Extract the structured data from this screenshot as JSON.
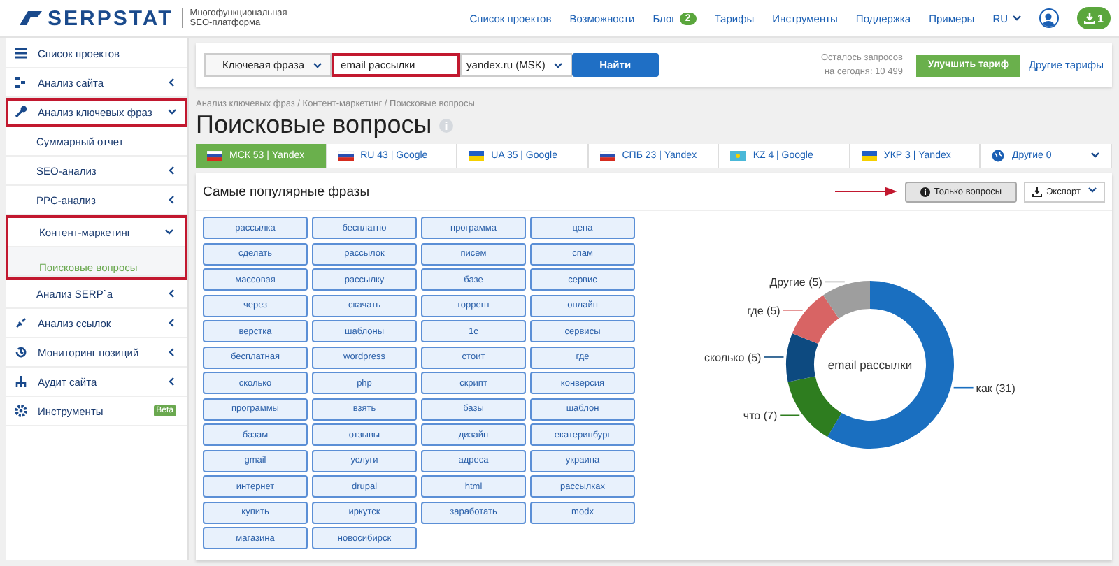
{
  "header": {
    "logo": "SERPSTAT",
    "tagline_1": "Многофункциональная",
    "tagline_2": "SEO-платформа",
    "nav": [
      {
        "label": "Список проектов"
      },
      {
        "label": "Возможности"
      },
      {
        "label": "Блог",
        "badge": "2"
      },
      {
        "label": "Тарифы"
      },
      {
        "label": "Инструменты"
      },
      {
        "label": "Поддержка"
      },
      {
        "label": "Примеры"
      }
    ],
    "language": "RU",
    "downloads": "1"
  },
  "sidebar": {
    "items": [
      {
        "label": "Список проектов",
        "highlighted": false
      },
      {
        "label": "Анализ сайта",
        "expanded": false,
        "highlighted": false
      },
      {
        "label": "Анализ ключевых фраз",
        "expanded": true,
        "highlighted": true,
        "children": [
          {
            "label": "Суммарный отчет",
            "selected": false,
            "highlighted": false
          },
          {
            "label": "SEO-анализ",
            "selected": false,
            "expanded": false,
            "highlighted": false,
            "collapsible": true
          },
          {
            "label": "PPC-анализ",
            "selected": false,
            "expanded": false,
            "highlighted": false,
            "collapsible": true
          },
          {
            "label": "Контент-маркетинг",
            "selected": false,
            "expanded": true,
            "highlighted": true,
            "collapsible": true,
            "children": [
              {
                "label": "Поисковые вопросы",
                "selected": true
              }
            ]
          },
          {
            "label": "Анализ SERP`a",
            "selected": false,
            "expanded": false,
            "highlighted": false,
            "collapsible": true
          }
        ]
      },
      {
        "label": "Анализ ссылок",
        "expanded": false,
        "highlighted": false
      },
      {
        "label": "Мониторинг позиций",
        "expanded": false,
        "highlighted": false
      },
      {
        "label": "Аудит сайта",
        "expanded": false,
        "highlighted": false
      },
      {
        "label": "Инструменты",
        "highlighted": false,
        "badge": "Beta"
      }
    ]
  },
  "search": {
    "type": "Ключевая фраза",
    "query": "email рассылки",
    "query_highlighted": true,
    "engine": "yandex.ru (MSK)",
    "button": "Найти",
    "quota_1": "Осталось запросов",
    "quota_2": "на сегодня: 10 499",
    "upgrade": "Улучшить тариф",
    "other_plans": "Другие тарифы"
  },
  "breadcrumb": "Анализ ключевых фраз / Контент-маркетинг / Поисковые вопросы",
  "title": "Поисковые вопросы",
  "regions": [
    {
      "label": "МСК 53 | Yandex",
      "selected": true
    },
    {
      "label": "RU 43 | Google",
      "selected": false
    },
    {
      "label": "UA 35 | Google",
      "selected": false
    },
    {
      "label": "СПБ 23 | Yandex",
      "selected": false
    },
    {
      "label": "KZ 4 | Google",
      "selected": false
    },
    {
      "label": "УКР 3 | Yandex",
      "selected": false
    },
    {
      "label": "Другие 0",
      "selected": false
    }
  ],
  "panel": {
    "title": "Самые популярные фразы",
    "questions_button": "Только вопросы",
    "questions_pointed": true,
    "export_button": "Экспорт",
    "phrases": [
      [
        "рассылка",
        "бесплатно",
        "программа",
        "цена"
      ],
      [
        "сделать",
        "рассылок",
        "писем",
        "спам"
      ],
      [
        "массовая",
        "рассылку",
        "базе",
        "сервис"
      ],
      [
        "через",
        "скачать",
        "торрент",
        "онлайн"
      ],
      [
        "верстка",
        "шаблоны",
        "1с",
        "сервисы"
      ],
      [
        "бесплатная",
        "wordpress",
        "стоит",
        "где"
      ],
      [
        "сколько",
        "php",
        "скрипт",
        "конверсия"
      ],
      [
        "программы",
        "взять",
        "базы",
        "шаблон"
      ],
      [
        "базам",
        "отзывы",
        "дизайн",
        "екатеринбург"
      ],
      [
        "gmail",
        "услуги",
        "адреса",
        "украина"
      ],
      [
        "интернет",
        "drupal",
        "html",
        "рассылках"
      ],
      [
        "купить",
        "иркутск",
        "заработать",
        "modx"
      ],
      [
        "магазина",
        "новосибирск"
      ]
    ],
    "chart_data": {
      "type": "donut",
      "title": "email рассылки",
      "values": [
        31,
        7,
        5,
        5,
        5
      ],
      "value_labels": [
        "как (31)",
        "что (7)",
        "сколько (5)",
        "где (5)",
        "Другие (5)"
      ]
    }
  }
}
